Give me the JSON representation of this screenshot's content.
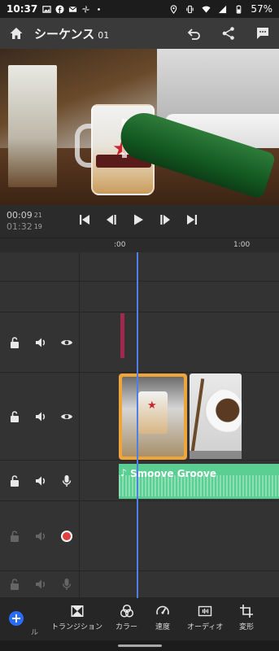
{
  "status_bar": {
    "time": "10:37",
    "battery": "57%",
    "icons": [
      "photo-icon",
      "facebook-icon",
      "gmail-icon",
      "pinwheel-icon",
      "dot-icon",
      "location-icon",
      "vibrate-icon",
      "wifi-icon",
      "signal-icon",
      "battery-icon"
    ]
  },
  "header": {
    "title": "シーケンス",
    "title_suffix": "01",
    "icons": [
      "home-icon",
      "undo-icon",
      "share-icon",
      "comment-icon"
    ]
  },
  "playback": {
    "current_time": "00:09",
    "current_frames": "21",
    "total_time": "01:32",
    "total_frames": "19",
    "controls": [
      "skip-to-start-icon",
      "step-back-icon",
      "play-icon",
      "step-forward-icon",
      "skip-to-end-icon"
    ]
  },
  "ruler": {
    "marks": [
      ":00",
      "1:00"
    ]
  },
  "audio_clip": {
    "name": "Smoove Groove"
  },
  "toolbar": {
    "partial_label": "ル",
    "tools": [
      {
        "label": "トランジション",
        "icon": "transition-icon"
      },
      {
        "label": "カラー",
        "icon": "color-icon"
      },
      {
        "label": "速度",
        "icon": "speed-icon"
      },
      {
        "label": "オーディオ",
        "icon": "audio-icon"
      },
      {
        "label": "変形",
        "icon": "transform-icon"
      }
    ]
  },
  "colors": {
    "accent": "#2a6cf5",
    "playhead": "#4f7fe5",
    "selected_clip": "#f0a53a",
    "audio_clip": "#5bcf93",
    "title_clip": "#a3284d",
    "record": "#e0413e"
  }
}
